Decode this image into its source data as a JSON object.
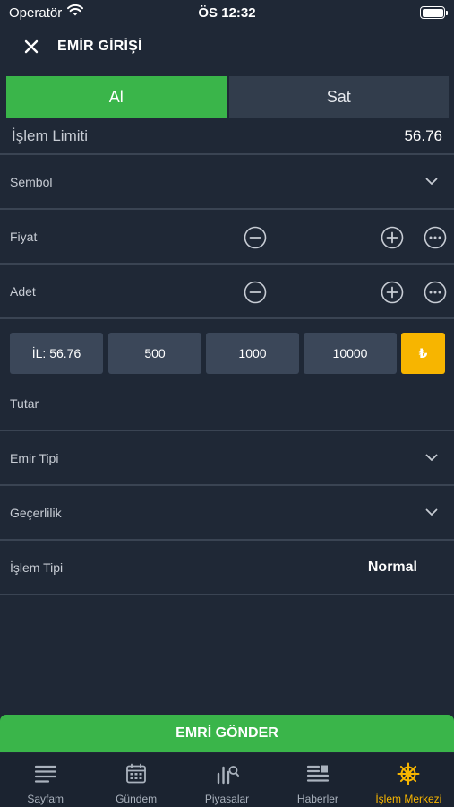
{
  "status_bar": {
    "carrier": "Operatör",
    "time": "ÖS 12:32"
  },
  "header": {
    "title": "EMİR GİRİŞİ"
  },
  "tabs": [
    {
      "label": "Al",
      "active": true
    },
    {
      "label": "Sat",
      "active": false
    }
  ],
  "limit": {
    "label": "İşlem Limiti",
    "value": "56.76"
  },
  "form": {
    "symbol_label": "Sembol",
    "price_label": "Fiyat",
    "quantity_label": "Adet",
    "amount_label": "Tutar",
    "order_type_label": "Emir Tipi",
    "validity_label": "Geçerlilik",
    "trade_type_label": "İşlem Tipi",
    "trade_type_value": "Normal"
  },
  "quick_amounts": [
    "İL: 56.76",
    "500",
    "1000",
    "10000"
  ],
  "currency_symbol": "₺",
  "submit_label": "EMRİ GÖNDER",
  "bottom_nav": [
    {
      "label": "Sayfam",
      "icon": "list-icon",
      "active": false
    },
    {
      "label": "Gündem",
      "icon": "calendar-icon",
      "active": false
    },
    {
      "label": "Piyasalar",
      "icon": "market-chart-icon",
      "active": false
    },
    {
      "label": "Haberler",
      "icon": "news-icon",
      "active": false
    },
    {
      "label": "İşlem Merkezi",
      "icon": "ship-wheel-icon",
      "active": true
    }
  ],
  "colors": {
    "background": "#1f2836",
    "buy_green": "#3ab54a",
    "accent_yellow": "#f7b500",
    "button_gray": "#3b4759"
  }
}
